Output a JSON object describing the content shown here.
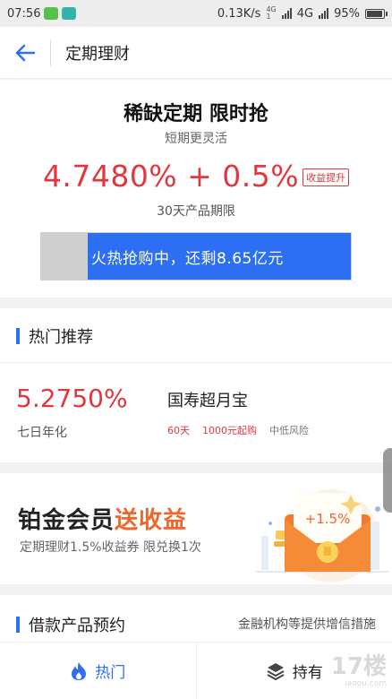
{
  "status_bar": {
    "time": "07:56",
    "speed": "0.13K/s",
    "network_small_top": "4G",
    "network_small_bottom": "1",
    "network": "4G",
    "battery": "95%"
  },
  "nav": {
    "title": "定期理财"
  },
  "hero": {
    "title": "稀缺定期 限时抢",
    "subtitle": "短期更灵活",
    "rate": "4.7480% + 0.5%",
    "rate_tag": "收益提升",
    "term": "30天产品期限",
    "progress_text": "火热抢购中，还剩8.65亿元",
    "progress_sold_fraction": 0.15
  },
  "hot": {
    "section_title": "热门推荐",
    "rate": "5.2750%",
    "rate_label": "七日年化",
    "product_name": "国寿超月宝",
    "tags": [
      "60天",
      "1000元起购",
      "中低风险"
    ]
  },
  "banner": {
    "title_main": "铂金会员",
    "title_accent": "送收益",
    "subtitle": "定期理财1.5%收益券 限兑换1次",
    "coupon_text": "+1.5%"
  },
  "loan": {
    "section_title": "借款产品预约",
    "note": "金融机构等提供增信措施",
    "tabs": [
      {
        "label": "热门",
        "icon": "flame-icon"
      },
      {
        "label": "持有",
        "icon": "layers-icon"
      }
    ]
  },
  "watermark": {
    "text": "17楼",
    "sub": "iaoou.com"
  },
  "colors": {
    "accent_blue": "#2d6ff2",
    "accent_red": "#e0383e",
    "accent_orange": "#f0652b"
  }
}
